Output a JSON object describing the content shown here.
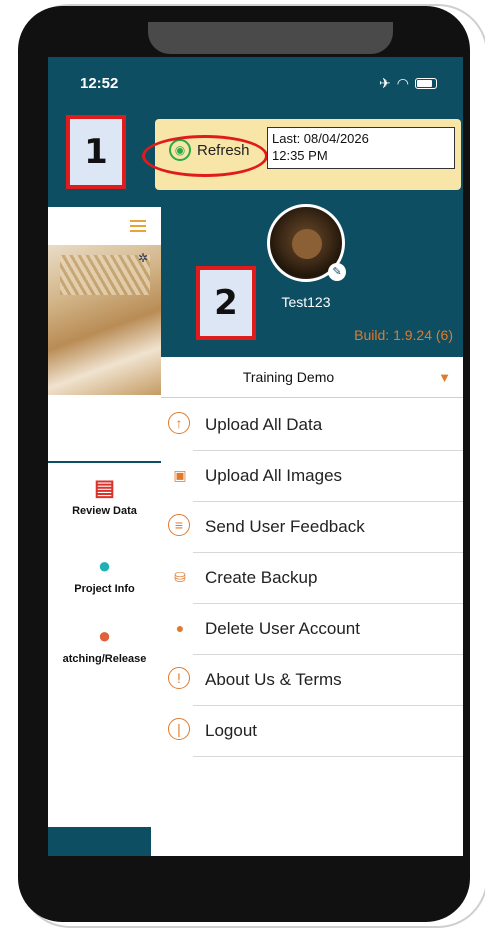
{
  "status_bar": {
    "time": "12:52",
    "icons": [
      "airplane-icon",
      "wifi-icon",
      "battery-icon"
    ]
  },
  "background_page": {
    "project_name": "Training Demo",
    "items": [
      {
        "label": "Review Data",
        "icon": "review-data-icon",
        "color": "#d9342b"
      },
      {
        "label": "Project Info",
        "icon": "info-icon",
        "color": "#20b2b2"
      },
      {
        "label": "atching/Release",
        "icon": "pin-icon",
        "color": "#e0623a"
      }
    ]
  },
  "drawer": {
    "refresh_label": "Refresh",
    "last_sync_line1": "Last: 08/04/2026",
    "last_sync_line2": "12:35 PM",
    "username": "Test123",
    "build": "Build: 1.9.24 (6)",
    "selected_project": "Training Demo",
    "menu": [
      {
        "label": "Upload All Data",
        "icon": "upload-icon"
      },
      {
        "label": "Upload All Images",
        "icon": "upload-image-icon"
      },
      {
        "label": "Send User Feedback",
        "icon": "feedback-icon"
      },
      {
        "label": "Create Backup",
        "icon": "backup-icon"
      },
      {
        "label": "Delete User Account",
        "icon": "delete-user-icon"
      },
      {
        "label": "About Us & Terms",
        "icon": "info-exclamation-icon"
      },
      {
        "label": "Logout",
        "icon": "power-icon"
      }
    ]
  },
  "callouts": {
    "one": "1",
    "two": "2"
  },
  "colors": {
    "header": "#0d4e63",
    "accent": "#e07a2c",
    "refresh_bg": "#f8e6a8",
    "highlight": "#e01b1b"
  }
}
